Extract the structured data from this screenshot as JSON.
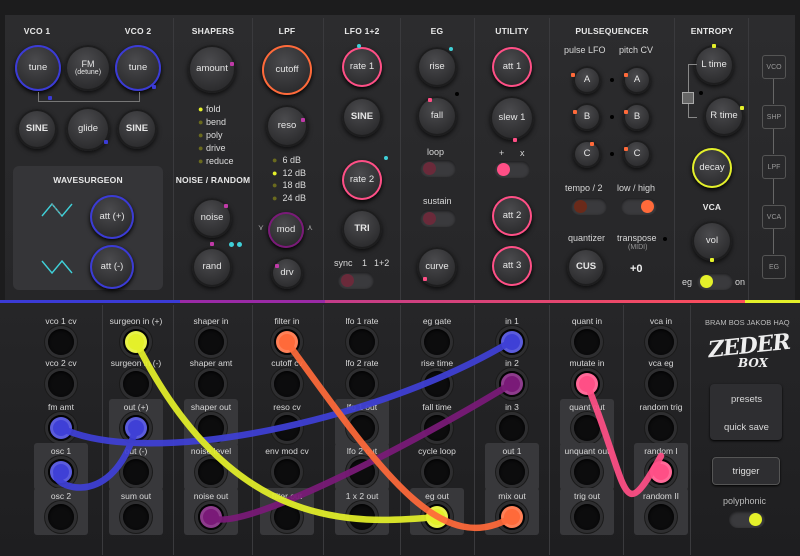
{
  "sections": {
    "vco1": "VCO 1",
    "vco2": "VCO 2",
    "shapers": "SHAPERS",
    "lpf": "LPF",
    "lfo": "LFO 1+2",
    "eg": "EG",
    "utility": "UTILITY",
    "pulse": "PULSEQUENCER",
    "entropy": "ENTROPY",
    "wave": "WAVESURGEON",
    "noise": "NOISE / RANDOM",
    "vca": "VCA"
  },
  "knobs": {
    "tune1": "tune",
    "fm": "FM",
    "fm_sub": "(detune)",
    "tune2": "tune",
    "sine1": "SINE",
    "glide": "glide",
    "sine2": "SINE",
    "amount": "amount",
    "cutoff": "cutoff",
    "reso": "reso",
    "rate1": "rate 1",
    "sine_lfo": "SINE",
    "rate2": "rate 2",
    "tri": "TRI",
    "rise": "rise",
    "fall": "fall",
    "curve": "curve",
    "att1": "att 1",
    "slew1": "slew 1",
    "att2": "att 2",
    "att3": "att 3",
    "A1": "A",
    "B1": "B",
    "C1": "C",
    "A2": "A",
    "B2": "B",
    "C2": "C",
    "cus": "CUS",
    "ltime": "L time",
    "rtime": "R time",
    "decay": "decay",
    "vol": "vol",
    "attp": "att (+)",
    "attm": "att (-)",
    "noise": "noise",
    "rand": "rand",
    "mod": "mod",
    "drv": "drv"
  },
  "shaper_modes": [
    "fold",
    "bend",
    "poly",
    "drive",
    "reduce"
  ],
  "db": [
    "6 dB",
    "12 dB",
    "18 dB",
    "24 dB"
  ],
  "labels": {
    "pulse_lfo": "pulse LFO",
    "pitch_cv": "pitch CV",
    "tempo": "tempo / 2",
    "lowhigh": "low / high",
    "quantizer": "quantizer",
    "transpose": "transpose",
    "midi": "(MIDI)",
    "trans_val": "+0",
    "loop": "loop",
    "sustain": "sustain",
    "plus": "+",
    "times": "x",
    "sync": "sync",
    "s1": "1",
    "s12": "1+2",
    "eg": "eg",
    "on": "on"
  },
  "side": [
    "VCO",
    "SHP",
    "LPF",
    "VCA",
    "EG"
  ],
  "jacks": [
    [
      "vco 1 cv",
      "vco 2 cv",
      "fm amt",
      "osc 1",
      "osc 2"
    ],
    [
      "surgeon in (+)",
      "surgeon in (-)",
      "out (+)",
      "out (-)",
      "sum out"
    ],
    [
      "shaper in",
      "shaper amt",
      "shaper out",
      "noise level",
      "noise out"
    ],
    [
      "filter in",
      "cutoff cv",
      "reso cv",
      "env mod cv",
      "filter out"
    ],
    [
      "lfo 1 rate",
      "lfo 2 rate",
      "lfo 1 out",
      "lfo 2 out",
      "1 x 2 out"
    ],
    [
      "eg gate",
      "rise time",
      "fall time",
      "cycle loop",
      "eg out"
    ],
    [
      "in 1",
      "in 2",
      "in 3",
      "out 1",
      "mix out"
    ],
    [
      "quant in",
      "mutate in",
      "quant out",
      "unquant out",
      "trig out"
    ],
    [
      "vca in",
      "vca eg",
      "random trig",
      "random I",
      "random II"
    ]
  ],
  "brand": {
    "credit": "BRAM BOS  JAKOB HAQ",
    "logo1": "ZEDER",
    "logo2": "BOX",
    "presets": "presets",
    "quicksave": "quick save",
    "trigger": "trigger",
    "poly": "polyphonic"
  },
  "colors": {
    "yellow": "#e4f02a",
    "orange": "#ff6a3a",
    "blue": "#3f40d6",
    "purple": "#7a1a78",
    "pink": "#ff4f86"
  }
}
